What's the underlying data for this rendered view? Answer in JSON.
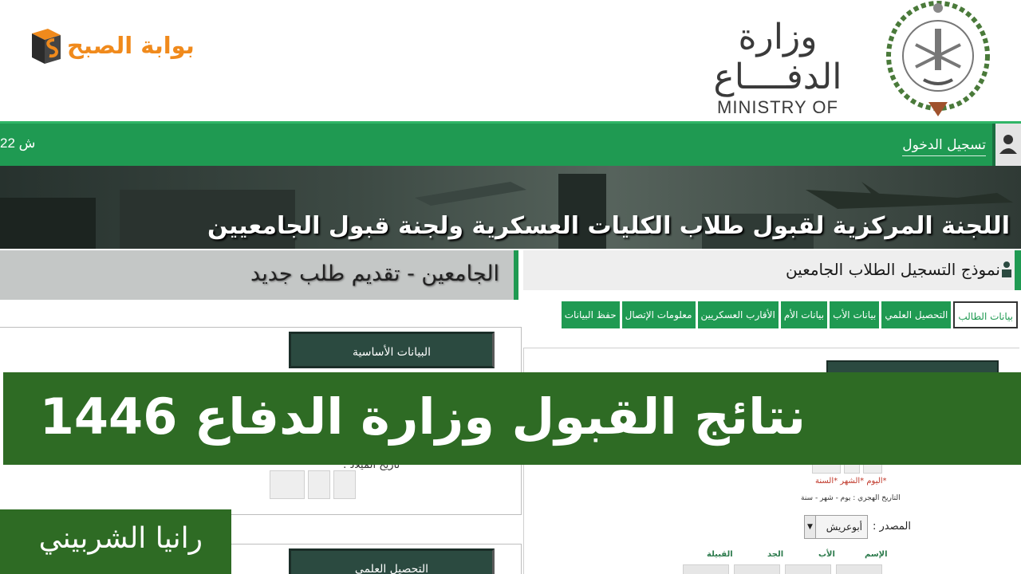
{
  "header": {
    "site_logo_text": "بوابة الصبح",
    "ministry_ar": "وزارة الدفــــاع",
    "ministry_en": "MINISTRY OF DEFENSE"
  },
  "navbar": {
    "date": "22 ش",
    "login_label": "تسجيل الدخول"
  },
  "banner": {
    "title": "اللجنة المركزية لقبول طلاب الكليات العسكرية ولجنة قبول الجامعيين"
  },
  "subheaders": {
    "left": "الجامعين - تقديم طلب جديد",
    "right": "نموذج التسجيل الطلاب الجامعين"
  },
  "tabs": [
    {
      "label": "بيانات الطالب",
      "active": true
    },
    {
      "label": "التحصيل العلمي"
    },
    {
      "label": "بيانات الأب"
    },
    {
      "label": "بيانات الأم"
    },
    {
      "label": "الأقارب العسكريين"
    },
    {
      "label": "معلومات الإتصال"
    },
    {
      "label": "حفظ البيانات"
    }
  ],
  "left_panel": {
    "basic_data_header": "البيانات الأساسية",
    "dob_label": "تاريخ الميلاد :",
    "education_header": "التحصيل العلمي"
  },
  "right_panel": {
    "hijri_fields": "*اليوم *الشهر *السنة",
    "hijri_note": "التاريخ الهجري : يوم - شهر - سنة",
    "source_label": "المصدر :",
    "source_value": "أبوعريش",
    "name_labels": [
      "الإسم",
      "الأب",
      "الجد",
      "القبيلة"
    ]
  },
  "overlay": {
    "headline": "نتائج القبول وزارة الدفاع 1446",
    "author": "رانيا الشربيني"
  },
  "colors": {
    "nav_green": "#1f9a52",
    "overlay_green": "#2e6b24",
    "section_dark": "#2b4a40",
    "logo_orange": "#f08a1c"
  }
}
